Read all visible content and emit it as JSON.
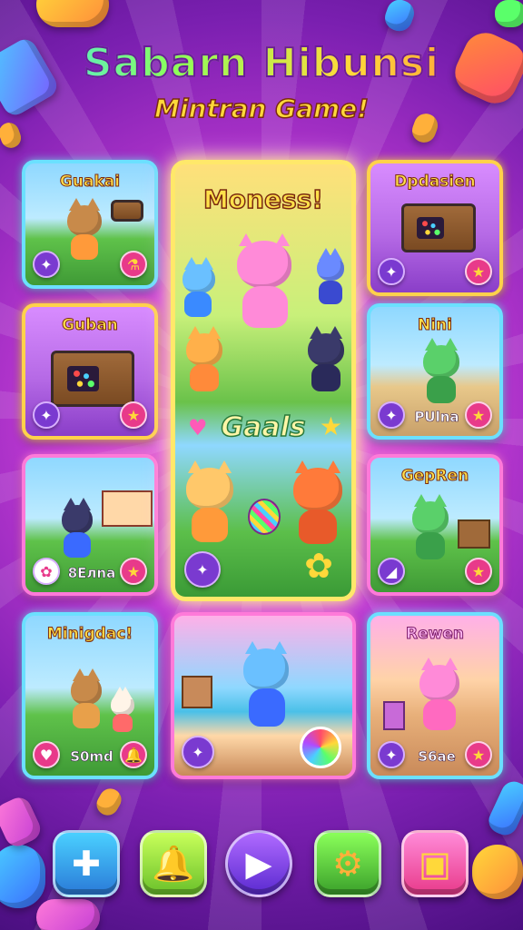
{
  "header": {
    "title": "Sabarn Hibunsi",
    "subtitle": "Mintran Game!"
  },
  "cards": [
    {
      "id": "guakai",
      "title": "Guakai",
      "label": ""
    },
    {
      "id": "guban",
      "title": "Guban",
      "label": ""
    },
    {
      "id": "bena",
      "title": "",
      "label": "8Eлna"
    },
    {
      "id": "minigdac",
      "title": "Minigdac!",
      "label": "S0md"
    },
    {
      "id": "dpdasien",
      "title": "Dpdasien",
      "label": ""
    },
    {
      "id": "nini",
      "title": "Nini",
      "label": "PUlna"
    },
    {
      "id": "gepren",
      "title": "GepRen",
      "label": ""
    },
    {
      "id": "rewen",
      "title": "Rewen",
      "label": "S6ae"
    }
  ],
  "featured": {
    "title": "Moness!",
    "goals_label": "Gaals"
  },
  "icons": {
    "card_left": "compass-icon",
    "card_right": "star-icon",
    "dock": [
      "puzzle-icon",
      "bell-icon",
      "play-icon",
      "gear-icon",
      "camera-icon"
    ]
  },
  "colors": {
    "accent_gold": "#ffe14a",
    "frame_cyan": "#6be0ff",
    "frame_pink": "#ff7ad9"
  }
}
